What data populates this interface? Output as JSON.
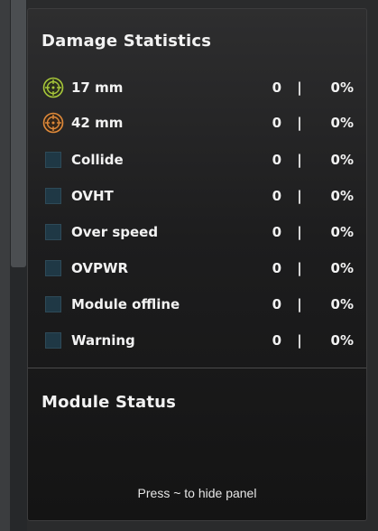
{
  "damage_statistics": {
    "title": "Damage Statistics",
    "rows": [
      {
        "icon": "crosshair-green-icon",
        "label": "17 mm",
        "count": "0",
        "separator": "|",
        "percent": "0%"
      },
      {
        "icon": "crosshair-orange-icon",
        "label": "42 mm",
        "count": "0",
        "separator": "|",
        "percent": "0%"
      },
      {
        "icon": "square-icon",
        "label": "Collide",
        "count": "0",
        "separator": "|",
        "percent": "0%"
      },
      {
        "icon": "square-icon",
        "label": "OVHT",
        "count": "0",
        "separator": "|",
        "percent": "0%"
      },
      {
        "icon": "square-icon",
        "label": "Over speed",
        "count": "0",
        "separator": "|",
        "percent": "0%"
      },
      {
        "icon": "square-icon",
        "label": "OVPWR",
        "count": "0",
        "separator": "|",
        "percent": "0%"
      },
      {
        "icon": "square-icon",
        "label": "Module offline",
        "count": "0",
        "separator": "|",
        "percent": "0%"
      },
      {
        "icon": "square-icon",
        "label": "Warning",
        "count": "0",
        "separator": "|",
        "percent": "0%"
      }
    ]
  },
  "module_status": {
    "title": "Module Status"
  },
  "footer": {
    "hint": "Press ~ to hide panel"
  },
  "colors": {
    "green_accent": "#a8c83a",
    "orange_accent": "#e08a3a",
    "square_fill": "#1f3845"
  }
}
